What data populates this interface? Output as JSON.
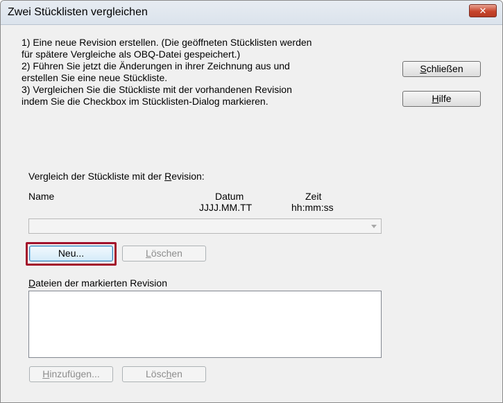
{
  "window": {
    "title": "Zwei Stücklisten vergleichen",
    "close_glyph": "✕"
  },
  "instructions": [
    "1) Eine neue Revision erstellen. (Die geöffneten Stücklisten werden",
    "für spätere Vergleiche als OBQ-Datei gespeichert.)",
    "2) Führen Sie jetzt die Änderungen in ihrer Zeichnung aus und",
    "erstellen Sie eine neue Stückliste.",
    "3) Vergleichen Sie die Stückliste mit der vorhandenen Revision",
    "indem Sie die Checkbox im Stücklisten-Dialog markieren."
  ],
  "side_buttons": {
    "close_label": "Schließen",
    "close_mnemonic": "S",
    "close_rest": "chließen",
    "help_mnemonic": "H",
    "help_rest": "ilfe"
  },
  "compare": {
    "label_pre": "Vergleich der Stückliste mit der ",
    "label_mnemonic": "R",
    "label_post": "evision:",
    "col_name": "Name",
    "col_date": "Datum",
    "col_date_format": "JJJJ.MM.TT",
    "col_time": "Zeit",
    "col_time_format": "hh:mm:ss",
    "combo_value": ""
  },
  "revision_buttons": {
    "new_label": "Neu...",
    "delete_mnemonic": "L",
    "delete_rest": "öschen"
  },
  "files": {
    "label_mnemonic": "D",
    "label_rest": "ateien der markierten Revision",
    "items": []
  },
  "file_buttons": {
    "add_mnemonic": "H",
    "add_rest": "inzufügen...",
    "delete_pre": "Lösc",
    "delete_mnemonic": "h",
    "delete_post": "en"
  },
  "colors": {
    "highlight": "#a3122b",
    "close_button": "#c7452c"
  }
}
